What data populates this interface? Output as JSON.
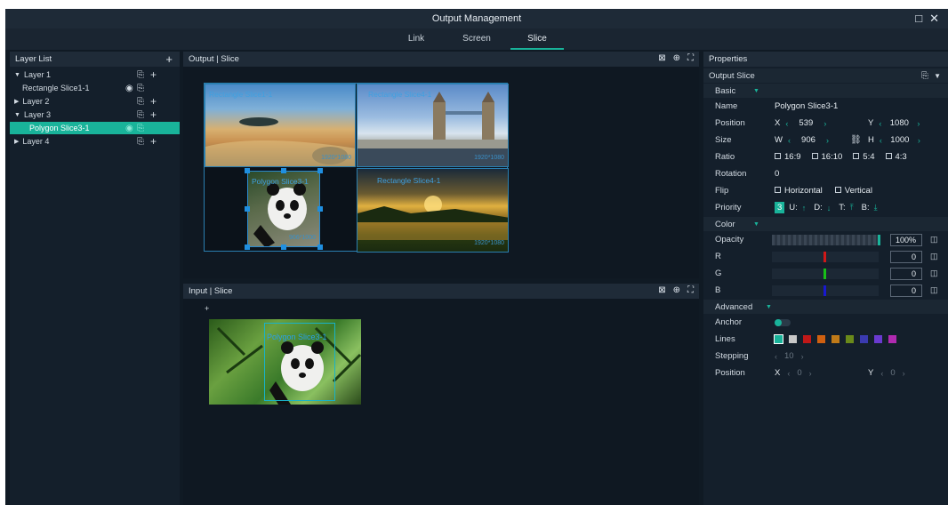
{
  "window": {
    "title": "Output Management",
    "maximize_icon": "□",
    "close_icon": "✕"
  },
  "tabs": [
    {
      "label": "Link"
    },
    {
      "label": "Screen"
    },
    {
      "label": "Slice",
      "active": true
    }
  ],
  "layer_list": {
    "title": "Layer List",
    "add_icon": "+",
    "rows": [
      {
        "label": "Layer 1",
        "expanded": true
      },
      {
        "label": "Rectangle Slice1-1"
      },
      {
        "label": "Layer 2",
        "expanded": false
      },
      {
        "label": "Layer 3",
        "expanded": true
      },
      {
        "label": "Polygon Slice3-1",
        "selected": true
      },
      {
        "label": "Layer 4",
        "expanded": false
      }
    ]
  },
  "output_panel": {
    "title": "Output | Slice",
    "slices": [
      {
        "label": "Rectangle Slice1-1",
        "size": "1920*1080"
      },
      {
        "label": "Rectangle Slice4-1",
        "size": "1920*1080"
      },
      {
        "label": "Polygon Slice3-1",
        "size": "906*1000"
      },
      {
        "label": "Rectangle Slice4-1",
        "size": "1920*1080"
      }
    ]
  },
  "input_panel": {
    "title": "Input | Slice",
    "slice_label": "Polygon Slice3-1"
  },
  "properties": {
    "title": "Properties",
    "output_slice": "Output Slice",
    "basic": "Basic",
    "name_label": "Name",
    "name_value": "Polygon Slice3-1",
    "position_label": "Position",
    "x_label": "X",
    "x_value": "539",
    "y_label": "Y",
    "y_value": "1080",
    "size_label": "Size",
    "w_label": "W",
    "w_value": "906",
    "h_label": "H",
    "h_value": "1000",
    "ratio_label": "Ratio",
    "ratios": [
      "16:9",
      "16:10",
      "5:4",
      "4:3"
    ],
    "rotation_label": "Rotation",
    "rotation_value": "0",
    "flip_label": "Flip",
    "flip_h": "Horizontal",
    "flip_v": "Vertical",
    "priority_label": "Priority",
    "priority_value": "3",
    "priority_u": "U:",
    "priority_d": "D:",
    "priority_t": "T:",
    "priority_b": "B:",
    "color": "Color",
    "opacity_label": "Opacity",
    "opacity_value": "100%",
    "opacity_level": 1.0,
    "r_label": "R",
    "r_value": "0",
    "g_label": "G",
    "g_value": "0",
    "b_label": "B",
    "b_value": "0",
    "advanced": "Advanced",
    "anchor_label": "Anchor",
    "lines_label": "Lines",
    "line_colors": [
      "#19b39a",
      "#c8c8c8",
      "#c01818",
      "#d06010",
      "#c07a18",
      "#6a8a1a",
      "#3a3ab0",
      "#6a3ad0",
      "#b02ab0"
    ],
    "stepping_label": "Stepping",
    "stepping_value": "10",
    "adv_position_label": "Position",
    "adv_x_label": "X",
    "adv_x_value": "0",
    "adv_y_label": "Y",
    "adv_y_value": "0",
    "accent": "#19b39a"
  }
}
